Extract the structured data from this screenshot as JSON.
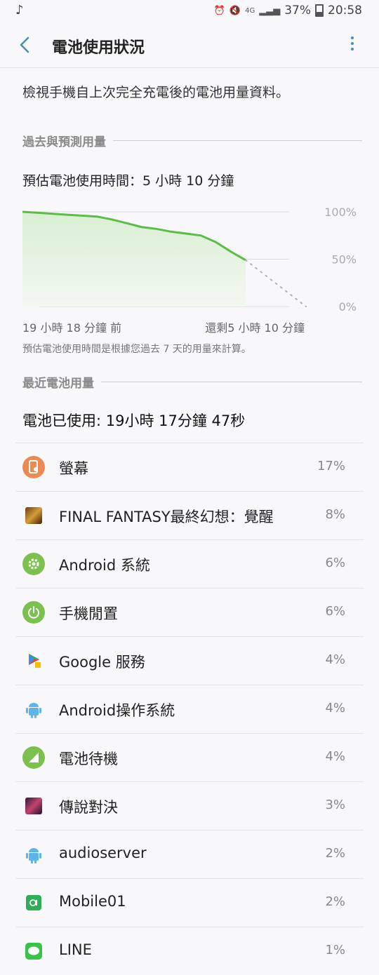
{
  "status_bar": {
    "left_icon": "music-note-icon",
    "network": "4G",
    "battery": "37%",
    "time": "20:58"
  },
  "app_bar": {
    "title": "電池使用狀況"
  },
  "description": "檢視手機自上次完全充電後的電池用量資料。",
  "section_past": "過去與預測用量",
  "estimate_text": "預估電池使用時間：5 小時 10 分鐘",
  "chart_data": {
    "type": "line",
    "y_ticks": [
      "100%",
      "50%",
      "0%"
    ],
    "x_start_label": "19 小時 18 分鐘 前",
    "x_end_label": "還剩5 小時 10 分鐘",
    "series": [
      {
        "values": [
          100,
          99,
          98,
          97,
          96,
          95,
          92,
          88,
          84,
          82,
          79,
          77,
          75,
          68,
          58,
          49
        ]
      },
      {
        "values": [
          49,
          0
        ]
      }
    ],
    "ylim": [
      0,
      100
    ],
    "colors": {
      "actual": "#5dbb4a",
      "projection": "#b0b0b0"
    }
  },
  "chart_note": "預估電池使用時間是根據您過去 7 天的用量來計算。",
  "section_recent": "最近電池用量",
  "used_text": "電池已使用: 19小時 17分鐘 47秒",
  "apps": [
    {
      "icon": "screen-icon",
      "name": "螢幕",
      "percent": "17%"
    },
    {
      "icon": "final-fantasy-icon",
      "name": "FINAL FANTASY最終幻想：覺醒",
      "percent": "8%"
    },
    {
      "icon": "android-system-icon",
      "name": "Android 系統",
      "percent": "6%"
    },
    {
      "icon": "phone-idle-icon",
      "name": "手機閒置",
      "percent": "6%"
    },
    {
      "icon": "google-services-icon",
      "name": "Google 服務",
      "percent": "4%"
    },
    {
      "icon": "android-os-icon",
      "name": "Android操作系統",
      "percent": "4%"
    },
    {
      "icon": "battery-standby-icon",
      "name": "電池待機",
      "percent": "4%"
    },
    {
      "icon": "arena-of-valor-icon",
      "name": "傳說對決",
      "percent": "3%"
    },
    {
      "icon": "audioserver-icon",
      "name": "audioserver",
      "percent": "2%"
    },
    {
      "icon": "mobile01-icon",
      "name": "Mobile01",
      "percent": "2%"
    },
    {
      "icon": "line-icon",
      "name": "LINE",
      "percent": "1%"
    }
  ]
}
